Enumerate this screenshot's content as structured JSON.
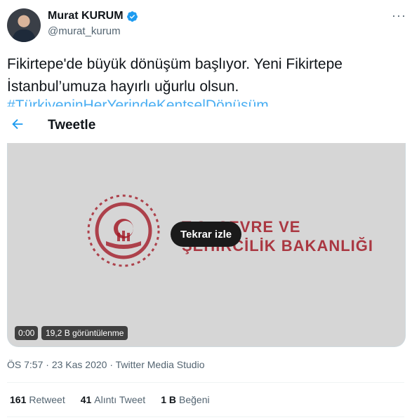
{
  "author": {
    "name": "Murat KURUM",
    "handle": "@murat_kurum",
    "verified": true,
    "avatar_icon": "profile-photo"
  },
  "more_icon": "more-horizontal-icon",
  "tweet": {
    "line1": "Fikirtepe'de büyük dönüşüm başlıyor. Yeni Fikirtepe",
    "line2": "İstanbul’umuza hayırlı uğurlu olsun.",
    "hashtag": "#TürkiyeninHerYerindeKentselDönüşüm"
  },
  "header": {
    "back_icon": "arrow-left-icon",
    "title": "Tweetle"
  },
  "video": {
    "logo_line1": "T.C. ÇEVRE VE",
    "logo_line2": "ŞEHİRCİLİK BAKANLIĞI",
    "replay_label": "Tekrar izle",
    "time": "0:00",
    "views": "19,2 B görüntülenme"
  },
  "meta": {
    "time": "ÖS 7:57",
    "separator1": " · ",
    "date": "23 Kas 2020",
    "separator2": " · ",
    "source": "Twitter Media Studio"
  },
  "stats": {
    "retweets_count": "161",
    "retweets_label": "Retweet",
    "quotes_count": "41",
    "quotes_label": "Alıntı Tweet",
    "likes_count": "1 B",
    "likes_label": "Beğeni"
  },
  "colors": {
    "accent": "#1d9bf0",
    "brand_red": "#a31c28",
    "secondary_text": "#536471"
  }
}
